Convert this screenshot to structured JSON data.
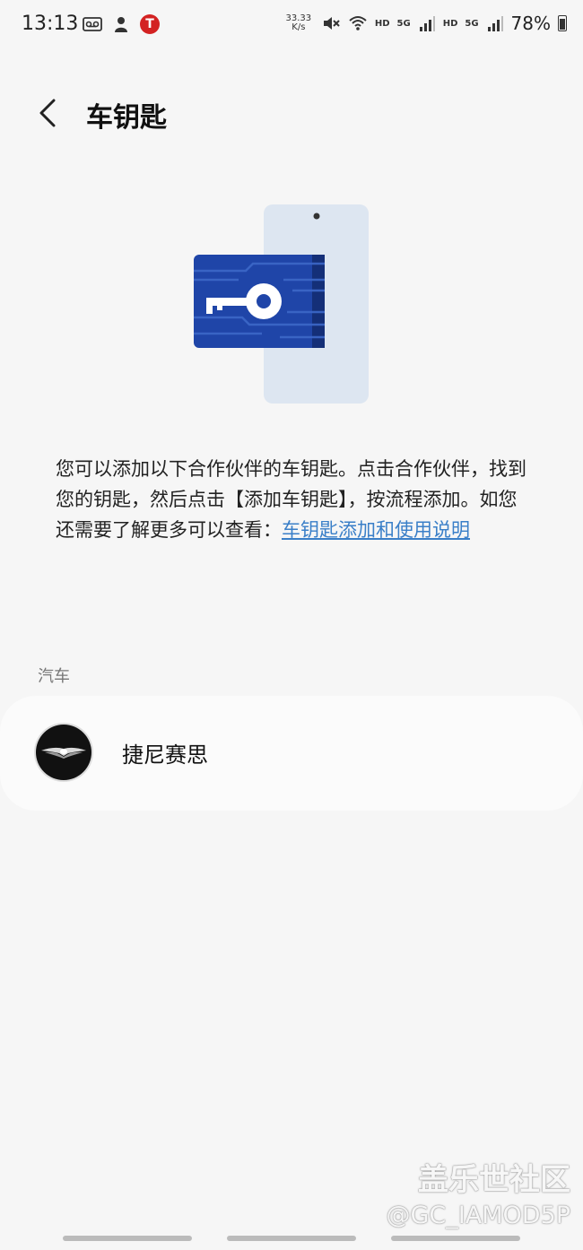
{
  "status_bar": {
    "time": "13:13",
    "net_speed_value": "33.33",
    "net_speed_unit": "K/s",
    "hd_label_1": "HD",
    "hd_label_2": "HD",
    "network_1": "5G",
    "network_2": "5G",
    "battery_percent": "78%"
  },
  "header": {
    "title": "车钥匙"
  },
  "description": {
    "text": "您可以添加以下合作伙伴的车钥匙。点击合作伙伴，找到您的钥匙，然后点击【添加车钥匙】，按流程添加。如您还需要了解更多可以查看：",
    "link_text": "车钥匙添加和使用说明"
  },
  "section": {
    "label": "汽车",
    "partners": [
      {
        "name": "捷尼赛思"
      }
    ]
  },
  "watermark": {
    "title": "盖乐世社区",
    "handle": "@GC_IAMOD5P"
  },
  "colors": {
    "background": "#f6f6f6",
    "card": "#fbfbfb",
    "link": "#3a7fc8",
    "key_card": "#1f45a8",
    "phone": "#dde6f1"
  }
}
